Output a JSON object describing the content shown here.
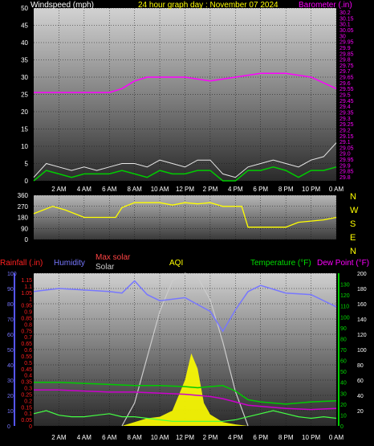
{
  "header": {
    "wind_label": "Windspeed (mph)",
    "title": "24 hour graph day : November 07 2024",
    "baro_label": "Barometer (.in)"
  },
  "compass": [
    "N",
    "W",
    "S",
    "E",
    "N"
  ],
  "bottom_labels": {
    "rain": "Rainfall (.in)",
    "humidity": "Humidity",
    "max_solar": "Max solar",
    "solar": "Solar",
    "aqi": "AQI",
    "temperature": "Temperature (°F)",
    "dewpoint": "Dew Point (°F)"
  },
  "colors": {
    "wind_speed": "#00cc00",
    "wind_gust": "#e8e8e8",
    "barometer": "#ff00ff",
    "direction": "#ffff00",
    "rain": "#ff2020",
    "humidity": "#7777ff",
    "temperature": "#00cc00",
    "dewpoint": "#cc00cc",
    "solar": "#ffff00",
    "max_solar": "#cccccc",
    "aqi": "#44ff44"
  },
  "chart_data": [
    {
      "type": "line",
      "title": "24 hour graph day : November 07 2024",
      "x_ticks": [
        "2 AM",
        "4 AM",
        "6 AM",
        "8 AM",
        "10 AM",
        "12 PM",
        "2 PM",
        "4 PM",
        "6 PM",
        "8 PM",
        "10 PM",
        "0 AM"
      ],
      "x_range_hours": [
        0,
        24
      ],
      "y_left": {
        "label": "Windspeed (mph)",
        "range": [
          0,
          50
        ],
        "ticks": [
          0,
          5,
          10,
          15,
          20,
          25,
          30,
          35,
          40,
          45,
          50
        ]
      },
      "y_right": {
        "label": "Barometer (.in)",
        "range": [
          29.8,
          30.25
        ],
        "ticks": [
          "29.8",
          "29.85",
          "29.9",
          "29.95",
          "29.0",
          "29.05",
          "29.1",
          "29.15",
          "29.2",
          "29.25",
          "29.3",
          "29.35",
          "29.4",
          "29.45",
          "29.5",
          "29.55",
          "29.6",
          "29.65",
          "29.7",
          "29.75",
          "29.8",
          "29.85",
          "29.9",
          "29.95",
          "30",
          "30.05",
          "30.1",
          "30.15",
          "30.2"
        ]
      },
      "series": [
        {
          "name": "Barometer",
          "axis": "right",
          "x": [
            0,
            2,
            4,
            6,
            7,
            8,
            9,
            10,
            12,
            14,
            16,
            18,
            20,
            22,
            24
          ],
          "values": [
            30.03,
            30.03,
            30.03,
            30.03,
            30.04,
            30.06,
            30.07,
            30.07,
            30.07,
            30.06,
            30.07,
            30.08,
            30.08,
            30.07,
            30.04
          ]
        },
        {
          "name": "Wind speed",
          "axis": "left",
          "x": [
            0,
            1,
            2,
            3,
            4,
            5,
            6,
            7,
            8,
            9,
            10,
            11,
            12,
            13,
            14,
            15,
            16,
            17,
            18,
            19,
            20,
            21,
            22,
            23,
            24
          ],
          "values": [
            0,
            3,
            2,
            1,
            2,
            2,
            2,
            3,
            2,
            1,
            3,
            2,
            2,
            3,
            3,
            0,
            0,
            3,
            3,
            4,
            3,
            1,
            3,
            3,
            4
          ]
        },
        {
          "name": "Wind gust",
          "axis": "left",
          "x": [
            0,
            1,
            2,
            3,
            4,
            5,
            6,
            7,
            8,
            9,
            10,
            11,
            12,
            13,
            14,
            15,
            16,
            17,
            18,
            19,
            20,
            21,
            22,
            23,
            24
          ],
          "values": [
            1,
            5,
            4,
            3,
            4,
            3,
            4,
            5,
            5,
            4,
            6,
            5,
            4,
            6,
            6,
            2,
            1,
            4,
            5,
            6,
            5,
            4,
            6,
            7,
            11
          ]
        }
      ]
    },
    {
      "type": "line",
      "title": "",
      "y_left": {
        "range": [
          0,
          360
        ],
        "ticks": [
          0,
          90,
          180,
          270,
          360
        ]
      },
      "series": [
        {
          "name": "Wind direction",
          "x": [
            0,
            1.5,
            2.5,
            4,
            5,
            6,
            6.5,
            7,
            8,
            9,
            10,
            11,
            12,
            13,
            14,
            15,
            16,
            16.5,
            17,
            18,
            19,
            20,
            21,
            22,
            23,
            24
          ],
          "values": [
            210,
            270,
            240,
            180,
            180,
            180,
            180,
            260,
            300,
            300,
            300,
            280,
            300,
            290,
            300,
            270,
            270,
            270,
            100,
            100,
            100,
            100,
            140,
            150,
            160,
            180
          ]
        }
      ]
    },
    {
      "type": "line",
      "title": "",
      "y_left_rain": {
        "label": "Rainfall (.in)",
        "range": [
          0,
          1.2
        ],
        "ticks": [
          0,
          0.05,
          0.1,
          0.15,
          0.2,
          0.25,
          0.3,
          0.35,
          0.4,
          0.45,
          0.5,
          0.55,
          0.6,
          0.65,
          0.7,
          0.75,
          0.8,
          0.85,
          0.9,
          0.95,
          1,
          1.05,
          1.1,
          1.15
        ]
      },
      "y_left_humidity": {
        "label": "Humidity",
        "range": [
          0,
          100
        ],
        "ticks": [
          0,
          10,
          20,
          30,
          40,
          50,
          60,
          70,
          80,
          90,
          100
        ]
      },
      "y_right_temp": {
        "label": "Temperature (°F)",
        "range": [
          0,
          140
        ],
        "ticks": [
          0,
          10,
          20,
          30,
          40,
          50,
          60,
          70,
          80,
          90,
          100,
          110,
          120,
          130
        ]
      },
      "y_right_solar": {
        "label": "Solar",
        "range": [
          0,
          200
        ],
        "ticks": [
          20,
          40,
          60,
          80,
          100,
          120,
          140,
          160,
          180,
          200
        ]
      },
      "series": [
        {
          "name": "Humidity",
          "x": [
            0,
            2,
            4,
            6,
            7,
            8,
            9,
            10,
            12,
            14,
            15,
            16,
            17,
            18,
            20,
            22,
            24
          ],
          "values": [
            88,
            90,
            89,
            88,
            87,
            95,
            86,
            82,
            84,
            75,
            62,
            76,
            88,
            92,
            87,
            86,
            78
          ]
        },
        {
          "name": "Temperature",
          "x": [
            0,
            2,
            4,
            6,
            8,
            10,
            12,
            13,
            14,
            15,
            16,
            17,
            18,
            20,
            22,
            24
          ],
          "values": [
            40,
            40,
            39,
            38,
            37,
            37,
            36,
            35,
            36,
            37,
            32,
            24,
            22,
            20,
            22,
            23
          ]
        },
        {
          "name": "Dew Point",
          "x": [
            0,
            2,
            4,
            6,
            8,
            10,
            12,
            13,
            14,
            15,
            16,
            17,
            18,
            20,
            22,
            24
          ],
          "values": [
            33,
            33,
            32,
            31,
            31,
            30,
            29,
            28,
            27,
            25,
            22,
            19,
            18,
            16,
            15,
            16
          ]
        },
        {
          "name": "Max solar",
          "x": [
            7,
            8,
            9,
            10,
            11,
            12,
            13,
            14,
            15,
            16,
            17
          ],
          "values": [
            0,
            30,
            90,
            150,
            190,
            200,
            195,
            165,
            110,
            45,
            0
          ]
        },
        {
          "name": "Solar",
          "x": [
            7,
            8,
            9,
            10,
            11,
            11.5,
            12,
            12.5,
            13,
            13.5,
            14,
            14.5,
            15,
            16,
            17
          ],
          "values": [
            0,
            5,
            10,
            12,
            20,
            40,
            60,
            95,
            75,
            30,
            15,
            10,
            5,
            2,
            0
          ]
        },
        {
          "name": "AQI",
          "x": [
            0,
            1,
            2,
            3,
            4,
            5,
            6,
            7,
            8,
            9,
            10,
            11,
            12,
            13,
            14,
            15,
            16,
            17,
            18,
            19,
            20,
            21,
            22,
            23,
            24
          ],
          "values": [
            8,
            10,
            7,
            6,
            6,
            7,
            8,
            6,
            6,
            5,
            4,
            3,
            3,
            3,
            3,
            3,
            4,
            6,
            8,
            10,
            8,
            6,
            5,
            6,
            5
          ]
        }
      ]
    }
  ]
}
